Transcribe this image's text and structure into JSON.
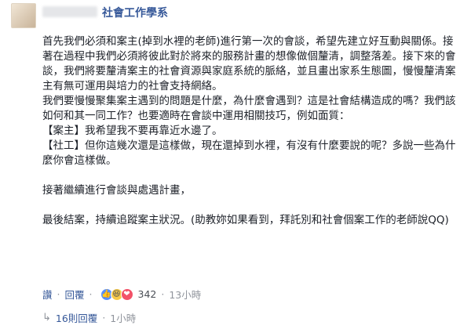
{
  "post": {
    "group_name": "社會工作學系",
    "paragraphs": [
      "首先我們必須和案主(掉到水裡的老師)進行第一次的會談，希望先建立好互動與關係。接著在過程中我們必須將彼此對於將來的服務計畫的想像做個釐清，調整落差。接下來的會談，我們將要釐清案主的社會資源與家庭系統的脈絡，並且畫出家系生態圖，慢慢釐清案主有無可運用與培力的社會支持網絡。",
      "我們要慢慢聚集案主遇到的問題是什麼，為什麼會遇到？這是社會結構造成的嗎？我們該如何和其一同工作？也要適時在會談中運用相關技巧，例如面質：",
      "【案主】我希望我不要再靠近水邊了。",
      "【社工】但你這幾次還是這樣做，現在還掉到水裡，有沒有什麼要說的呢？多說一些為什麼你會這樣做。",
      "",
      "接著繼續進行會談與處遇計畫，",
      "",
      "最後結案，持續追蹤案主狀況。(助教妳如果看到，拜託別和社會個案工作的老師說QQ)"
    ]
  },
  "footer": {
    "like_label": "讚",
    "reply_label": "回覆",
    "reaction_count": "342",
    "time": "13小時"
  },
  "replies": {
    "label": "16則回覆",
    "separator": "·",
    "time": "1小時"
  },
  "icons": {
    "like": "thumbs-up-icon",
    "haha": "laughing-face-icon",
    "love": "heart-icon",
    "reply_arrow": "reply-arrow-icon"
  }
}
